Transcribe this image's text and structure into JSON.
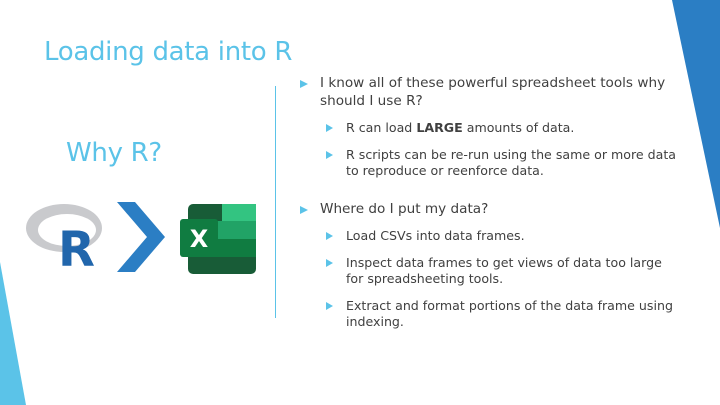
{
  "slide": {
    "title": "Loading data into R",
    "subtitle": "Why R?",
    "r_logo_letter": "R",
    "excel_logo_letter": "X",
    "colors": {
      "accent": "#5bc3e8",
      "accent_dark": "#2b7ec4",
      "text": "#404040",
      "excel_green": "#1e7145"
    },
    "bullets": [
      {
        "text": "I know all of these powerful spreadsheet tools why should I use R?",
        "sub": [
          {
            "pre": "R can load ",
            "bold": "LARGE",
            "post": " amounts of data."
          },
          {
            "text": "R scripts can be re-run using the same or more data to reproduce or reenforce data."
          }
        ]
      },
      {
        "text": "Where do I put my data?",
        "sub": [
          {
            "text": "Load CSVs into data frames."
          },
          {
            "text": "Inspect data frames to get views of data too large for spreadsheeting tools."
          },
          {
            "text": "Extract and format portions of the data frame using indexing."
          }
        ]
      }
    ]
  }
}
